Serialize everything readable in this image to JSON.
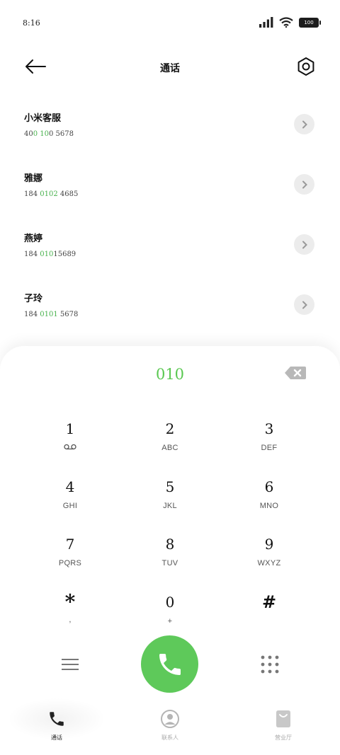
{
  "status": {
    "time": "8:16",
    "battery": "100"
  },
  "header": {
    "title": "通话"
  },
  "contacts": [
    {
      "name": "小米客服",
      "number_pre": "40",
      "number_hl": "0 10",
      "number_post": "0  5678"
    },
    {
      "name": "雅娜",
      "number_pre": "184  ",
      "number_hl": "0102",
      "number_post": "  4685"
    },
    {
      "name": "燕婷",
      "number_pre": "184  ",
      "number_hl": "010",
      "number_post": "15689"
    },
    {
      "name": "子玲",
      "number_pre": "184  ",
      "number_hl": "0101",
      "number_post": "  5678"
    }
  ],
  "dial": {
    "input": "010"
  },
  "keys": [
    {
      "digit": "1",
      "letters": ""
    },
    {
      "digit": "2",
      "letters": "ABC"
    },
    {
      "digit": "3",
      "letters": "DEF"
    },
    {
      "digit": "4",
      "letters": "GHI"
    },
    {
      "digit": "5",
      "letters": "JKL"
    },
    {
      "digit": "6",
      "letters": "MNO"
    },
    {
      "digit": "7",
      "letters": "PQRS"
    },
    {
      "digit": "8",
      "letters": "TUV"
    },
    {
      "digit": "9",
      "letters": "WXYZ"
    },
    {
      "digit": "*",
      "letters": ","
    },
    {
      "digit": "0",
      "letters": "+"
    },
    {
      "digit": "#",
      "letters": ""
    }
  ],
  "tabs": [
    {
      "label": "通话",
      "icon": "phone-icon"
    },
    {
      "label": "联系人",
      "icon": "contacts-icon"
    },
    {
      "label": "营业厅",
      "icon": "store-bag-icon"
    }
  ],
  "colors": {
    "accent": "#5ec95a",
    "highlight": "#48b24d"
  }
}
